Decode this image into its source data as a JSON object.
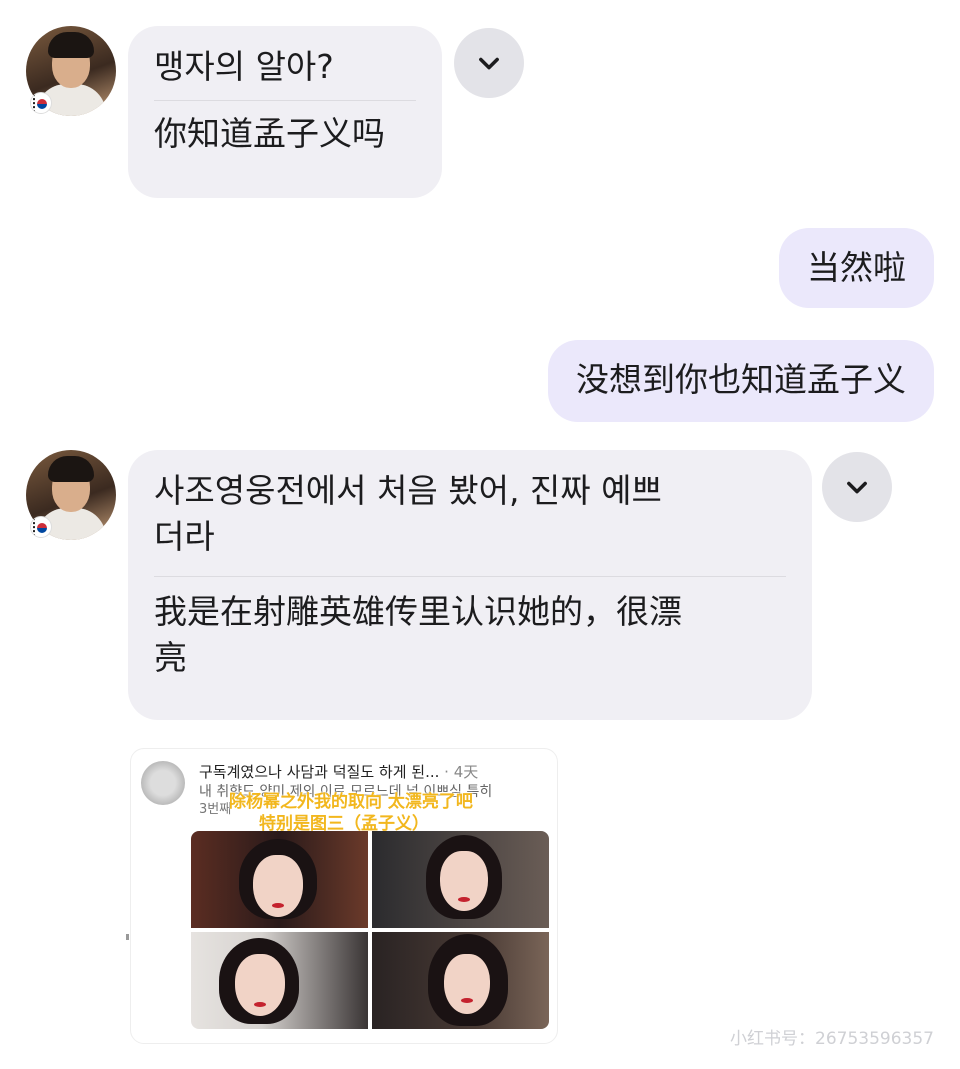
{
  "messages": [
    {
      "id": "m1",
      "direction": "in",
      "original": "맹자의 알아?",
      "translation": "你知道孟子义吗"
    },
    {
      "id": "m2",
      "direction": "out",
      "text": "当然啦"
    },
    {
      "id": "m3",
      "direction": "out",
      "text": "没想到你也知道孟子义"
    },
    {
      "id": "m4",
      "direction": "in",
      "original_line1": "사조영웅전에서 처음 봤어, 진짜 예쁘",
      "original_line2": "더라",
      "translation_line1": "我是在射雕英雄传里认识她的，很漂",
      "translation_line2": "亮"
    }
  ],
  "icons": {
    "expand": "chevron-down-icon",
    "flag": "korea-flag-icon"
  },
  "shared_post": {
    "title": "구독계였으나 사담과 덕질도 하게 된...",
    "time": "· 4天",
    "body_line1": "내 취향드 양미 제외 이르 모르느데 넘 이쁘심 특히",
    "body_line2": "3번째",
    "caption_line1": "除杨幂之外我的取向 太漂亮了吧",
    "caption_line2": "特别是图三（孟子义）"
  },
  "watermark": "小红书号：26753596357",
  "colors": {
    "incoming_bubble": "#f0eff4",
    "outgoing_bubble": "#ebe8fb",
    "caption": "#f2b71e"
  }
}
